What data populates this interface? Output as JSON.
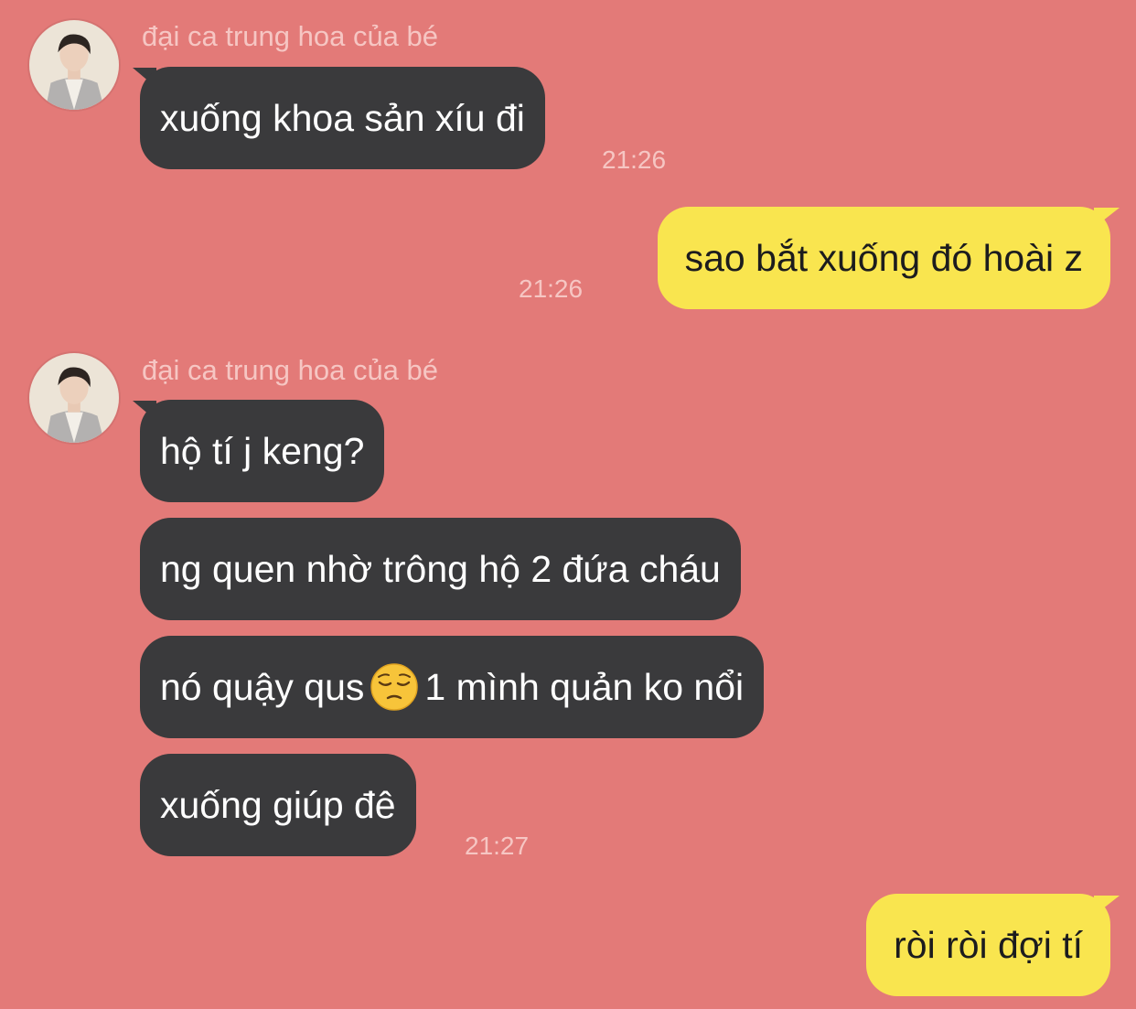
{
  "conversation": {
    "contact_name": "đại ca trung hoa của bé",
    "blocks": [
      {
        "sender": "đại ca trung hoa của bé",
        "messages": [
          "xuống khoa sản xíu đi"
        ],
        "time": "21:26"
      },
      {
        "sender": "me",
        "messages": [
          "sao bắt xuống đó hoài z"
        ],
        "time": "21:26"
      },
      {
        "sender": "đại ca trung hoa của bé",
        "messages": [
          "hộ tí j keng?",
          "ng quen nhờ trông hộ 2 đứa cháu",
          {
            "before": "nó quậy qus",
            "emoji": "pensive-face-emoji",
            "after": "1 mình quản ko nổi"
          },
          "xuống giúp đê"
        ],
        "time": "21:27"
      },
      {
        "sender": "me",
        "messages": [
          "ròi ròi đợi tí"
        ],
        "time": ""
      }
    ]
  },
  "colors": {
    "background": "#e37a78",
    "incoming_bubble": "#3a3a3c",
    "outgoing_bubble": "#f9e54f",
    "meta_text": "#f6c6c3"
  }
}
